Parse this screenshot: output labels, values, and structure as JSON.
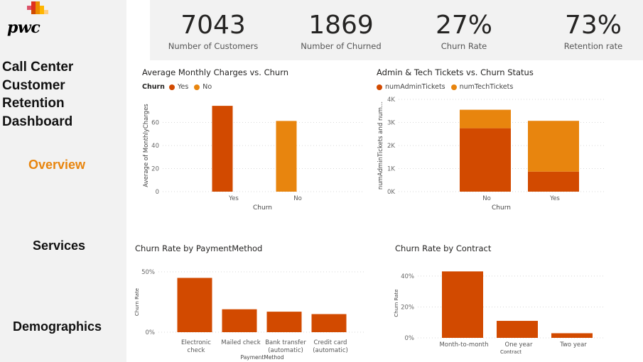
{
  "brand": {
    "logo_text": "pwc"
  },
  "sidebar": {
    "title": "Call Center\nCustomer\nRetention\nDashboard",
    "nav": [
      {
        "label": "Overview",
        "active": true
      },
      {
        "label": "Services",
        "active": false
      },
      {
        "label": "Demographics",
        "active": false
      }
    ]
  },
  "kpis": [
    {
      "value": "7043",
      "label": "Number of Customers"
    },
    {
      "value": "1869",
      "label": "Number of Churned"
    },
    {
      "value": "27%",
      "label": "Churn Rate"
    },
    {
      "value": "73%",
      "label": "Retention rate"
    }
  ],
  "colors": {
    "primary": "#d24a00",
    "secondary": "#e8850e",
    "nav_active": "#e8850e"
  },
  "chart_data": [
    {
      "type": "bar",
      "title": "Average Monthly Charges vs. Churn",
      "legend_title": "Churn",
      "legend": [
        "Yes",
        "No"
      ],
      "categories": [
        "Yes",
        "No"
      ],
      "values": [
        74.4,
        61.3
      ],
      "xlabel": "Churn",
      "ylabel": "Average of MonthlyCharges",
      "yticks": [
        "0",
        "20",
        "40",
        "60"
      ],
      "ylim": [
        0,
        80
      ],
      "grid": true
    },
    {
      "type": "bar",
      "stacked": true,
      "title": "Admin & Tech Tickets vs. Churn Status",
      "legend": [
        "numAdminTickets",
        "numTechTickets"
      ],
      "categories": [
        "No",
        "Yes"
      ],
      "series": [
        {
          "name": "numAdminTickets",
          "values": [
            2750,
            870
          ]
        },
        {
          "name": "numTechTickets",
          "values": [
            800,
            2200
          ]
        }
      ],
      "xlabel": "Churn",
      "ylabel": "numAdminTickets and num...",
      "yticks": [
        "0K",
        "1K",
        "2K",
        "3K",
        "4K"
      ],
      "ylim": [
        0,
        4000
      ],
      "grid": true
    },
    {
      "type": "bar",
      "title": "Churn Rate by PaymentMethod",
      "categories": [
        "Electronic check",
        "Mailed check",
        "Bank transfer (automatic)",
        "Credit card (automatic)"
      ],
      "category_lines": [
        [
          "Electronic",
          "check"
        ],
        [
          "Mailed check"
        ],
        [
          "Bank transfer",
          "(automatic)"
        ],
        [
          "Credit card",
          "(automatic)"
        ]
      ],
      "values": [
        45,
        19,
        17,
        15
      ],
      "xlabel": "PaymentMethod",
      "ylabel": "Churn Rate",
      "yticks": [
        "0%",
        "50%"
      ],
      "ylim": [
        0,
        50
      ],
      "grid": true
    },
    {
      "type": "bar",
      "title": "Churn Rate by Contract",
      "categories": [
        "Month-to-month",
        "One year",
        "Two year"
      ],
      "values": [
        43,
        11,
        3
      ],
      "xlabel": "Contract",
      "ylabel": "Churn Rate",
      "yticks": [
        "0%",
        "20%",
        "40%"
      ],
      "ylim": [
        0,
        45
      ],
      "grid": true
    }
  ]
}
